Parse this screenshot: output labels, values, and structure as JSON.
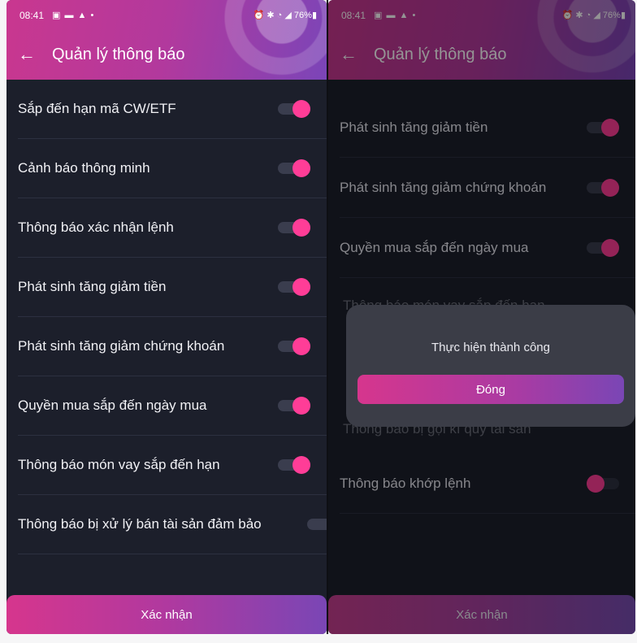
{
  "status_bar": {
    "time": "08:41",
    "left_icons": "▣ ▬ ▲ •",
    "right_icons": "⏰ ✱ ◔ ◢",
    "battery": "76%"
  },
  "header": {
    "title": "Quản lý thông báo",
    "back_icon": "arrow-left-icon"
  },
  "left_panel": {
    "items": [
      {
        "label": "Sắp đến hạn mã CW/ETF",
        "enabled": true
      },
      {
        "label": "Cảnh báo thông minh",
        "enabled": true
      },
      {
        "label": "Thông báo xác nhận lệnh",
        "enabled": true
      },
      {
        "label": "Phát sinh tăng giảm tiền",
        "enabled": true
      },
      {
        "label": "Phát sinh tăng giảm chứng khoán",
        "enabled": true
      },
      {
        "label": "Quyền mua sắp đến ngày mua",
        "enabled": true
      },
      {
        "label": "Thông báo món vay sắp đến hạn",
        "enabled": true
      },
      {
        "label": "Thông báo bị xử lý bán tài sản đảm bảo",
        "enabled": true
      }
    ],
    "confirm_label": "Xác nhận"
  },
  "right_panel": {
    "items": [
      {
        "label": "Phát sinh tăng giảm tiền",
        "enabled": true
      },
      {
        "label": "Phát sinh tăng giảm chứng khoán",
        "enabled": true
      },
      {
        "label": "Quyền mua sắp đến ngày mua",
        "enabled": true
      },
      {
        "label": "Thông báo khớp lệnh",
        "enabled": false
      }
    ],
    "ghost_above": "Thông báo món vay sắp đến hạn",
    "ghost_below": "Thông báo bị gọi kí quỹ tài sản",
    "confirm_label": "Xác nhận",
    "dialog": {
      "message": "Thực hiện thành công",
      "button_label": "Đóng"
    }
  },
  "colors": {
    "accent_pink": "#ff3d97",
    "accent_purple": "#7a46b5",
    "background": "#1c1f2b"
  }
}
